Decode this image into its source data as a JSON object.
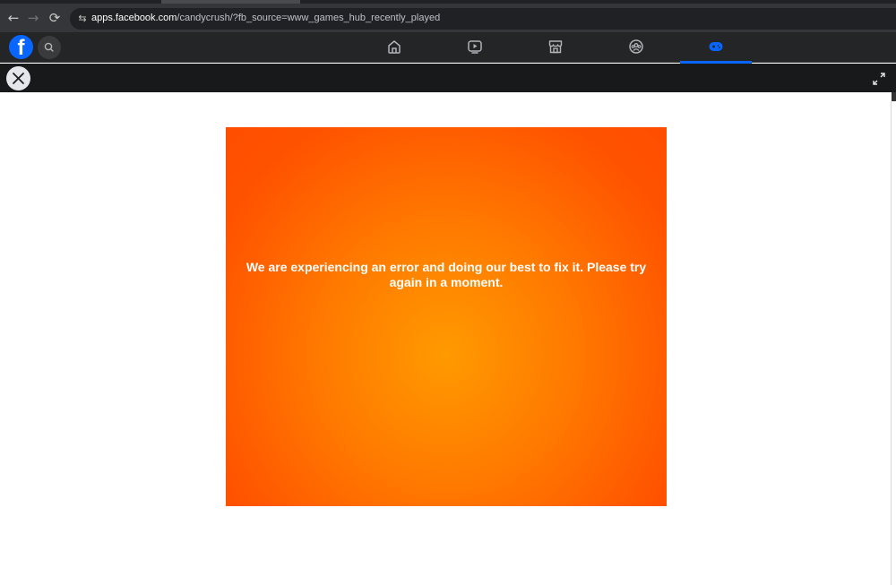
{
  "browser": {
    "back_icon": "←",
    "forward_icon": "→",
    "reload_icon": "⟳",
    "site_info_icon": "⇆",
    "url_host": "apps.facebook.com",
    "url_rest": "/candycrush/?fb_source=www_games_hub_recently_played"
  },
  "fb_header": {
    "logo": "f",
    "nav": [
      "home",
      "video",
      "marketplace",
      "groups",
      "gaming"
    ],
    "active_nav": "gaming",
    "accent_color": "#0866ff"
  },
  "game": {
    "error_message": "We are experiencing an error and doing our best to fix it. Please try again in a moment.",
    "background_center": "#ff9a00",
    "background_edge": "#ff4d00"
  }
}
